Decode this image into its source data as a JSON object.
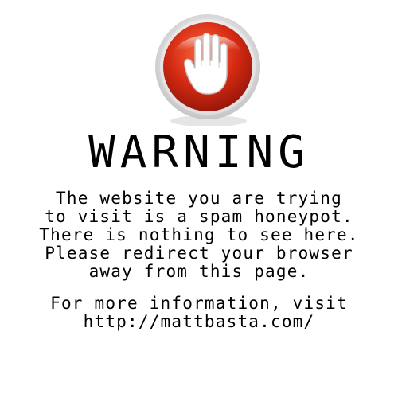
{
  "warning": {
    "title": "WARNING",
    "message_lines": [
      "The website you are trying",
      "to visit is a spam honeypot.",
      "There is nothing to see here.",
      "Please redirect your browser",
      "away from this page."
    ],
    "info_lines": [
      "For more information, visit",
      "http://mattbasta.com/"
    ]
  },
  "icons": {
    "stop_icon": "stop-hand-icon"
  },
  "colors": {
    "background": "#ffffff",
    "text": "#000000",
    "icon_red": "#d32a12",
    "icon_ring": "#d9d9d9",
    "hand": "#ffffff"
  }
}
